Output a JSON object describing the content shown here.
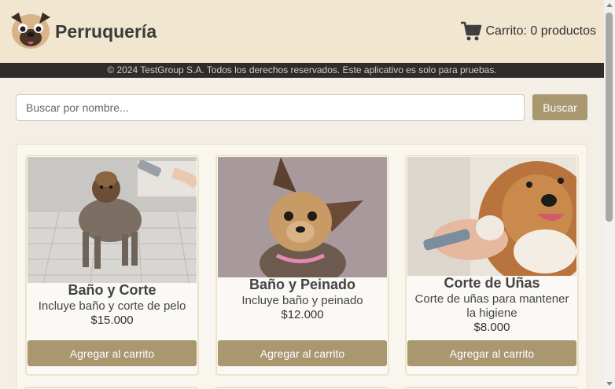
{
  "header": {
    "brand": "Perruquería",
    "logo_icon": "pug-logo-icon",
    "cart_icon": "shopping-cart-icon",
    "cart_label": "Carrito: 0 productos"
  },
  "notice": {
    "text": "© 2024 TestGroup S.A. Todos los derechos reservados. Este aplicativo es solo para pruebas."
  },
  "search": {
    "placeholder": "Buscar por nombre...",
    "value": "",
    "button_label": "Buscar"
  },
  "products": [
    {
      "title": "Baño y Corte",
      "description": "Incluye baño y corte de pelo",
      "price": "$15.000",
      "button_label": "Agregar al carrito",
      "image": "dog-bath-photo"
    },
    {
      "title": "Baño y Peinado",
      "description": "Incluye baño y peinado",
      "price": "$12.000",
      "button_label": "Agregar al carrito",
      "image": "yorkie-groomed-photo"
    },
    {
      "title": "Corte de Uñas",
      "description": "Corte de uñas para mantener la higiene",
      "price": "$8.000",
      "button_label": "Agregar al carrito",
      "image": "collie-nail-trim-photo"
    }
  ],
  "colors": {
    "header_bg": "#f1e6d0",
    "notice_bg": "#2e2d2b",
    "accent": "#a8976f",
    "page_bg": "#f3efe7"
  }
}
